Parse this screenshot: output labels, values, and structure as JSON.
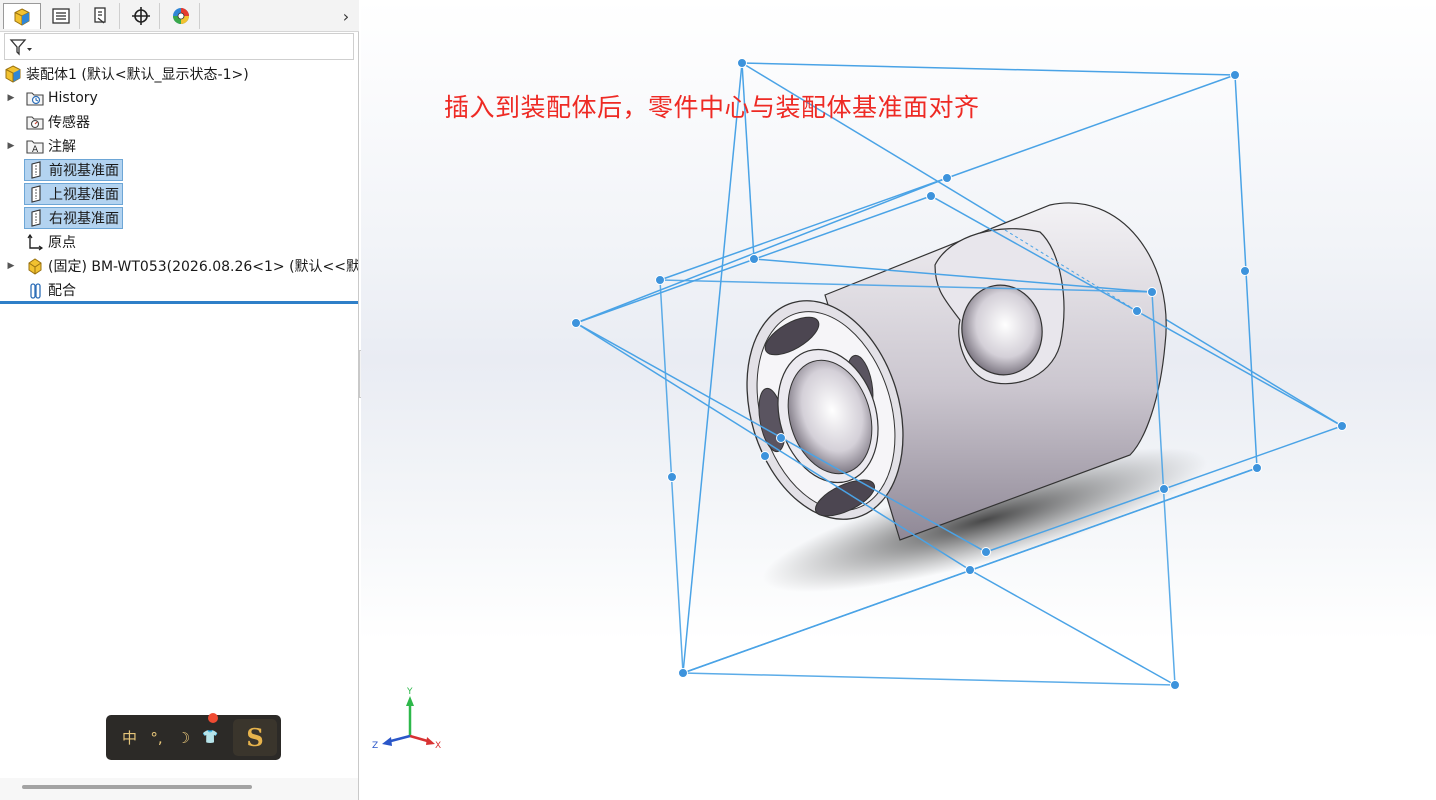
{
  "tabs": [
    {
      "name": "featuremanager-tab",
      "icon": "assembly-cube-icon"
    },
    {
      "name": "propertymanager-tab",
      "icon": "property-list-icon"
    },
    {
      "name": "configurationmanager-tab",
      "icon": "configuration-icon"
    },
    {
      "name": "dimxpert-tab",
      "icon": "crosshair-target-icon"
    },
    {
      "name": "displaymanager-tab",
      "icon": "color-wheel-icon"
    }
  ],
  "tab_more": "›",
  "filter": {
    "icon": "funnel-filter-icon",
    "value": ""
  },
  "tree": {
    "root": "装配体1  (默认<默认_显示状态-1>)",
    "history": "History",
    "sensors": "传感器",
    "annotations": "注解",
    "front_plane": "前视基准面",
    "top_plane": "上视基准面",
    "right_plane": "右视基准面",
    "origin": "原点",
    "part": "(固定) BM-WT053(2026.08.26<1> (默认<<默",
    "mates": "配合"
  },
  "ime": {
    "items": [
      "中",
      "°,",
      "☽",
      "👕"
    ],
    "logo": "S"
  },
  "viewport": {
    "annotation": "插入到装配体后，零件中心与装配体基准面对齐"
  },
  "triad": {
    "x": "X",
    "y": "Y",
    "z": "Z"
  },
  "colors": {
    "plane_edge": "#4aa3e6",
    "plane_handle": "#3d93dc",
    "annotation": "#ee2a24",
    "selection": "#b3d3f0",
    "part_body": "#d8d6dc"
  }
}
